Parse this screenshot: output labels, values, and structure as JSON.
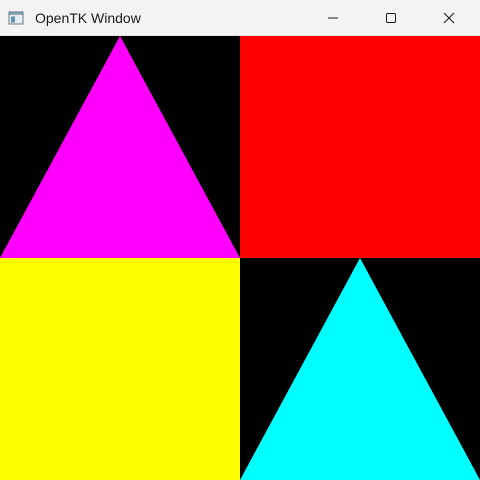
{
  "window": {
    "title": "OpenTK Window",
    "controls": {
      "minimize_icon": "minimize-icon",
      "maximize_icon": "maximize-icon",
      "close_icon": "close-icon"
    }
  },
  "scene": {
    "background": "#000000",
    "shapes": [
      {
        "name": "triangle-top-left",
        "kind": "triangle",
        "color": "#ff00ff"
      },
      {
        "name": "square-top-right",
        "kind": "rectangle",
        "color": "#ff0000"
      },
      {
        "name": "square-bottom-left",
        "kind": "rectangle",
        "color": "#ffff00"
      },
      {
        "name": "triangle-bottom-right",
        "kind": "triangle",
        "color": "#00ffff"
      }
    ]
  }
}
